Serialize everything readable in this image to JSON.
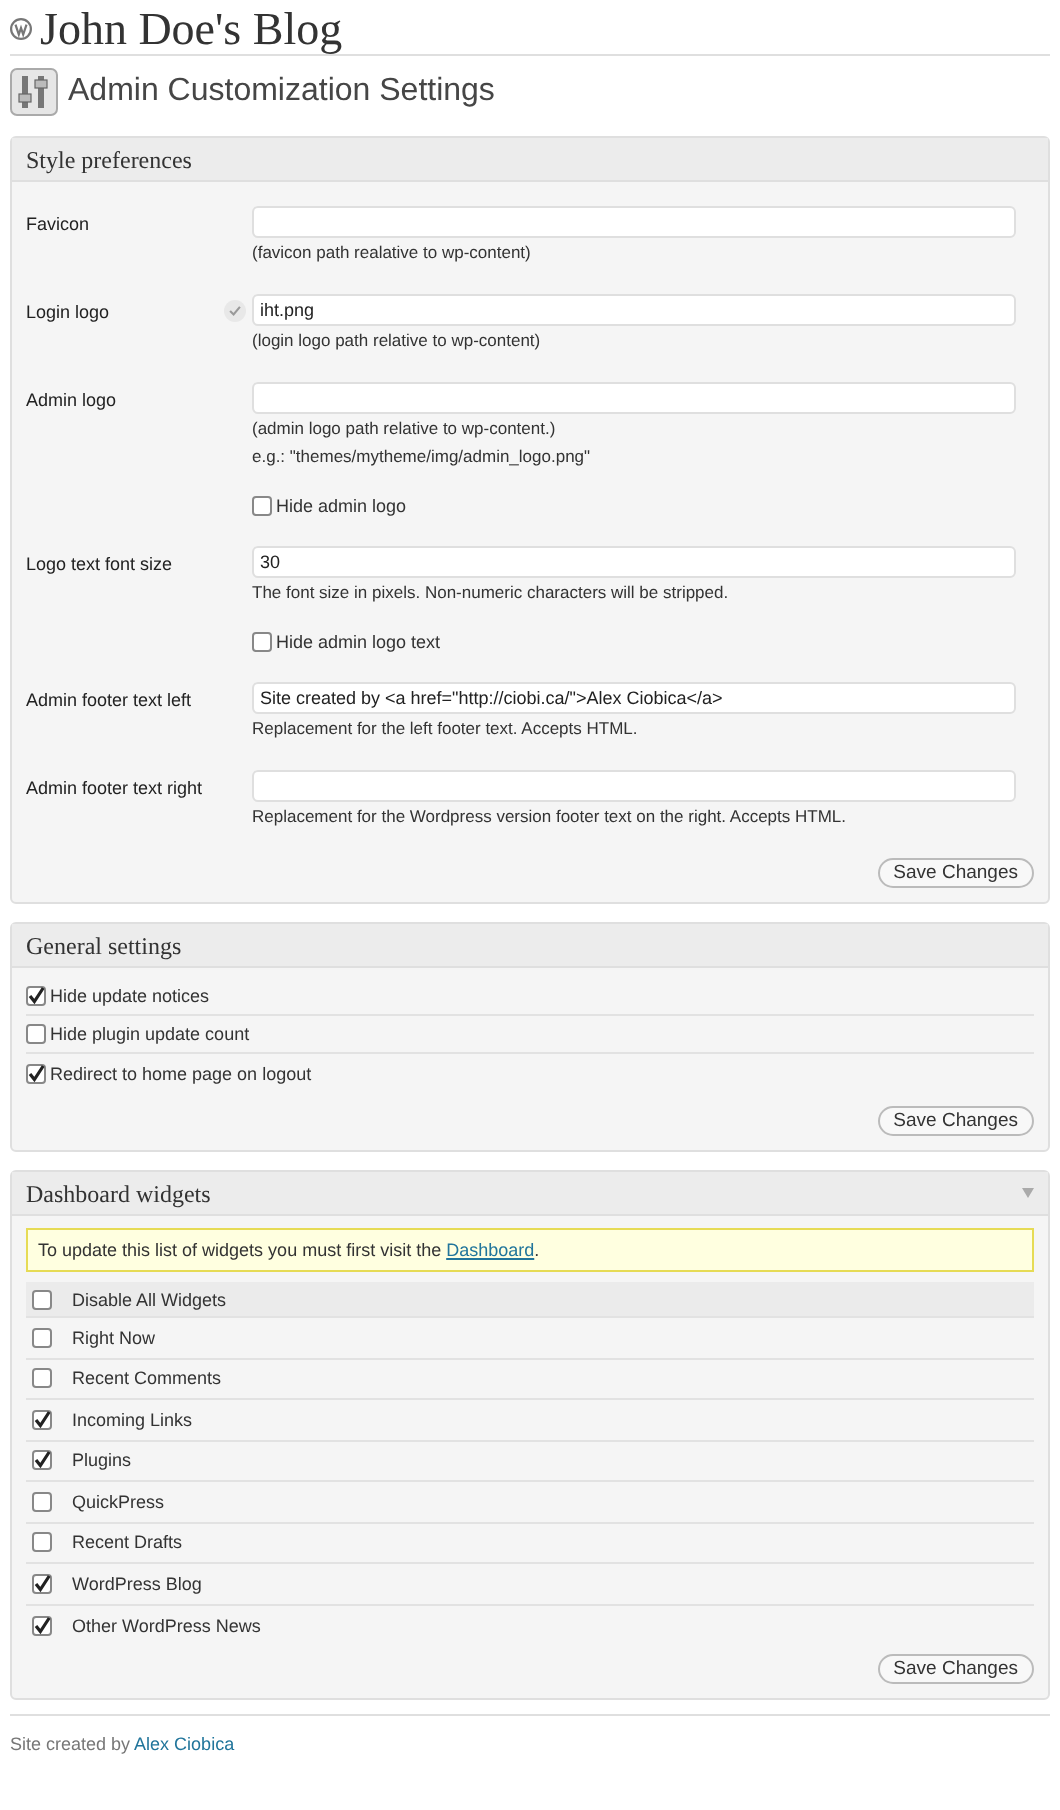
{
  "site_title": "John Doe's Blog",
  "page_title": "Admin Customization Settings",
  "style_preferences": {
    "title": "Style preferences",
    "rows": [
      {
        "kind": "field",
        "label": "Favicon",
        "value": "",
        "validated": false,
        "hints": [
          "(favicon path realative to wp-content)"
        ]
      },
      {
        "kind": "field",
        "label": "Login logo",
        "value": "iht.png",
        "validated": true,
        "hints": [
          "(login logo path relative to wp-content)"
        ]
      },
      {
        "kind": "field",
        "label": "Admin logo",
        "value": "",
        "validated": false,
        "hints": [
          "(admin logo path relative to wp-content.)",
          "e.g.: \"themes/mytheme/img/admin_logo.png\""
        ]
      },
      {
        "kind": "checkbox",
        "label": "Hide admin logo",
        "checked": false
      },
      {
        "kind": "field",
        "label": "Logo text font size",
        "value": "30",
        "validated": false,
        "hints": [
          "The font size in pixels. Non-numeric characters will be stripped."
        ]
      },
      {
        "kind": "checkbox",
        "label": "Hide admin logo text",
        "checked": false
      },
      {
        "kind": "field",
        "label": "Admin footer text left",
        "value": "Site created by <a href=\"http://ciobi.ca/\">Alex Ciobica</a>",
        "validated": false,
        "hints": [
          "Replacement for the left footer text. Accepts HTML."
        ]
      },
      {
        "kind": "field",
        "label": "Admin footer text right",
        "value": "",
        "validated": false,
        "hints": [
          "Replacement for the Wordpress version footer text on the right. Accepts HTML."
        ]
      }
    ],
    "button": "Save Changes"
  },
  "general_settings": {
    "title": "General settings",
    "options": [
      {
        "label": "Hide update notices",
        "checked": true
      },
      {
        "label": "Hide plugin update count",
        "checked": false
      },
      {
        "label": "Redirect to home page on logout",
        "checked": true
      }
    ],
    "button": "Save Changes"
  },
  "dashboard_widgets": {
    "title": "Dashboard widgets",
    "notice": {
      "text": "To update this list of widgets you must first visit the",
      "link": "Dashboard",
      "end": "."
    },
    "widgets": [
      {
        "kind": "all",
        "label": "Disable All Widgets",
        "checked": false
      },
      {
        "kind": "widget",
        "label": "Right Now",
        "checked": false
      },
      {
        "kind": "widget",
        "label": "Recent Comments",
        "checked": false
      },
      {
        "kind": "widget",
        "label": "Incoming Links",
        "checked": true
      },
      {
        "kind": "widget",
        "label": "Plugins",
        "checked": true
      },
      {
        "kind": "widget",
        "label": "QuickPress",
        "checked": false
      },
      {
        "kind": "widget",
        "label": "Recent Drafts",
        "checked": false
      },
      {
        "kind": "widget",
        "label": "WordPress Blog",
        "checked": true
      },
      {
        "kind": "widget",
        "label": "Other WordPress News",
        "checked": true
      }
    ],
    "button": "Save Changes"
  },
  "footer": {
    "text": "Site created by",
    "link": "Alex Ciobica"
  }
}
